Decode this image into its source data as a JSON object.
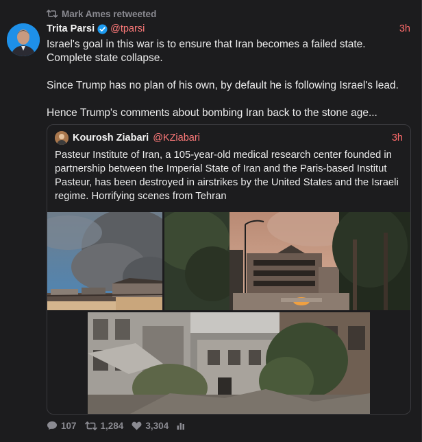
{
  "retweet": {
    "label": "Mark Ames retweeted",
    "icon": "retweet-icon"
  },
  "tweet": {
    "author_name": "Trita Parsi",
    "author_handle": "@tparsi",
    "verified_icon": "verified-badge-icon",
    "time": "3h",
    "paragraphs": [
      "Israel's goal in this war is to ensure that Iran becomes a failed state. Complete state collapse.",
      "Since Trump has no plan of his own, by default he is following Israel's lead.",
      "Hence Trump's comments about bombing Iran back to the stone age..."
    ]
  },
  "quote": {
    "author_name": "Kourosh Ziabari",
    "author_handle": "@KZiabari",
    "time": "3h",
    "text": "Pasteur Institute of Iran, a 105-year-old medical research center founded in partnership between the Imperial State of Iran and the Paris-based Institut Pasteur, has been destroyed in airstrikes by the United States and the Israeli regime. Horrifying scenes from Tehran",
    "media": [
      {
        "description_icon": "photo-smoke-over-building"
      },
      {
        "description_icon": "photo-damaged-building-street"
      },
      {
        "description_icon": "photo-destroyed-courtyard"
      }
    ]
  },
  "actions": {
    "replies": "107",
    "retweets": "1,284",
    "likes": "3,304",
    "reply_icon": "reply-icon",
    "retweet_icon": "retweet-icon",
    "like_icon": "heart-icon",
    "stats_icon": "stats-icon"
  },
  "colors": {
    "background": "#1c1c1e",
    "handle": "#ff7a7a",
    "time": "#ff6b6b",
    "muted": "#8b8b92",
    "verified": "#1d9bf0"
  }
}
